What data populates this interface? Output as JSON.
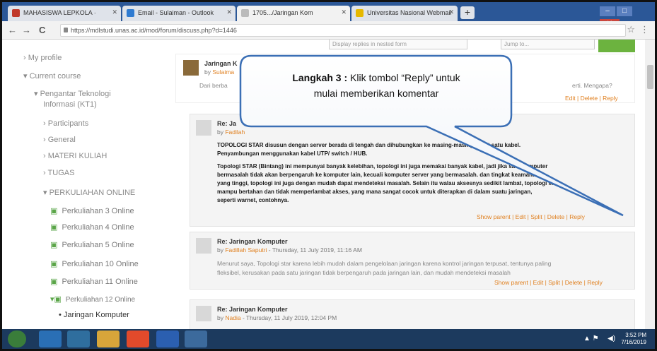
{
  "browser": {
    "tabs": [
      {
        "label": "MAHASISWA LEPKOLA ·",
        "color": "#c0392b"
      },
      {
        "label": "Email - Sulaiman - Outlook",
        "color": "#2f7bd1"
      },
      {
        "label": "1705.../Jaringan Kom",
        "color": "#e8e8e8"
      },
      {
        "label": "Universitas Nasional Webmail",
        "color": "#e6b800"
      }
    ],
    "new_tab": "+",
    "url": "https://mdlstudi.unas.ac.id/mod/forum/discuss.php?d=1446",
    "back": "←",
    "forward": "→",
    "reload": "C",
    "star": "☆",
    "menu": "⋮"
  },
  "topbar": {
    "select_left": "Display replies in nested form",
    "select_right": "Jump to...",
    "go_label": ""
  },
  "sidebar": {
    "items": [
      {
        "label": "My profile",
        "prefix": "›",
        "indent": 0
      },
      {
        "label": "Current course",
        "prefix": "▾",
        "indent": 0
      },
      {
        "label": "Pengantar Teknologi",
        "prefix": "▾",
        "indent": 1
      },
      {
        "label": "Informasi (KT1)",
        "prefix": "",
        "indent": 1
      },
      {
        "label": "Participants",
        "prefix": "›",
        "indent": 2
      },
      {
        "label": "General",
        "prefix": "›",
        "indent": 2
      },
      {
        "label": "MATERI KULIAH",
        "prefix": "›",
        "indent": 2
      },
      {
        "label": "TUGAS",
        "prefix": "›",
        "indent": 2
      },
      {
        "label": "PERKULIAHAN ONLINE",
        "prefix": "▾",
        "indent": 2
      },
      {
        "label": "Perkuliahan 3 Online",
        "prefix": "icon",
        "indent": 3
      },
      {
        "label": "Perkuliahan 4 Online",
        "prefix": "icon",
        "indent": 3
      },
      {
        "label": "Perkuliahan 5 Online",
        "prefix": "icon",
        "indent": 3
      },
      {
        "label": "Perkuliahan 10 Online",
        "prefix": "icon",
        "indent": 3
      },
      {
        "label": "Perkuliahan 11 Online",
        "prefix": "icon",
        "indent": 3
      },
      {
        "label": "Perkuliahan 12 Online",
        "prefix": "icon-open",
        "indent": 3
      },
      {
        "label": "Jaringan Komputer",
        "prefix": "•",
        "indent": 4
      }
    ]
  },
  "posts": [
    {
      "title": "Jaringan K",
      "author_prefix": "by",
      "author": "Sulaima",
      "date": "",
      "body": "Dari berba",
      "body_tail": "erti. Mengapa?",
      "actions": "Edit | Delete | Reply"
    },
    {
      "title": "Re: Ja",
      "author_prefix": "by",
      "author": "Fadilah",
      "date": "",
      "body_lines": [
        "TOPOLOGI STAR disusun dengan server berada di tengah dan dihubungkan ke masing-masing klient satu kabel.",
        "Penyambungan menggunakan kabel UTP/ switch / HUB.",
        "",
        "Topologi STAR (Bintang) ini mempunyai banyak kelebihan, topologi ini juga memakai banyak kabel, jadi jika satu komputer",
        "bermasalah tidak akan berpengaruh ke komputer lain, kecuali komputer server yang bermasalah. dan tingkat keamanan",
        "yang tinggi, topologi ini juga dengan mudah dapat mendeteksi masalah. Selain itu walau aksesnya sedikit lambat, topologi ini",
        "mampu bertahan dan tidak memperlambat akses, yang mana sangat cocok untuk diterapkan di dalam suatu jaringan,",
        "seperti warnet, contohnya."
      ],
      "actions": "Show parent | Edit | Split | Delete | Reply"
    },
    {
      "title": "Re: Jaringan Komputer",
      "author_prefix": "by",
      "author": "Fadillah Saputri",
      "date": " - Thursday, 11 July 2019, 11:16 AM",
      "body_lines": [
        "Menurut saya, Topologi star karena lebih mudah dalam pengelolaan jaringan karena kontrol jaringan terpusat, tentunya paling",
        "fleksibel, kerusakan pada satu jaringan tidak berpengaruh pada jaringan lain, dan mudah mendeteksi masalah"
      ],
      "actions": "Show parent | Edit | Split | Delete | Reply"
    },
    {
      "title": "Re: Jaringan Komputer",
      "author_prefix": "by",
      "author": "Nadia",
      "date": " - Thursday, 11 July 2019, 12:04 PM",
      "body_lines": [],
      "actions": ""
    }
  ],
  "callout": {
    "bold": "Langkah 3 :",
    "line1_rest": " Klik  tombol “Reply” untuk",
    "line2": "mulai memberikan komentar"
  },
  "taskbar": {
    "time": "3:52 PM",
    "date": "7/16/2019"
  },
  "colors": {
    "tabstrip": "#2b5797",
    "link": "#e08020",
    "green_icon": "#5aa548",
    "taskbar": "#1c3a5e",
    "callout_border": "#3b6fb5"
  }
}
